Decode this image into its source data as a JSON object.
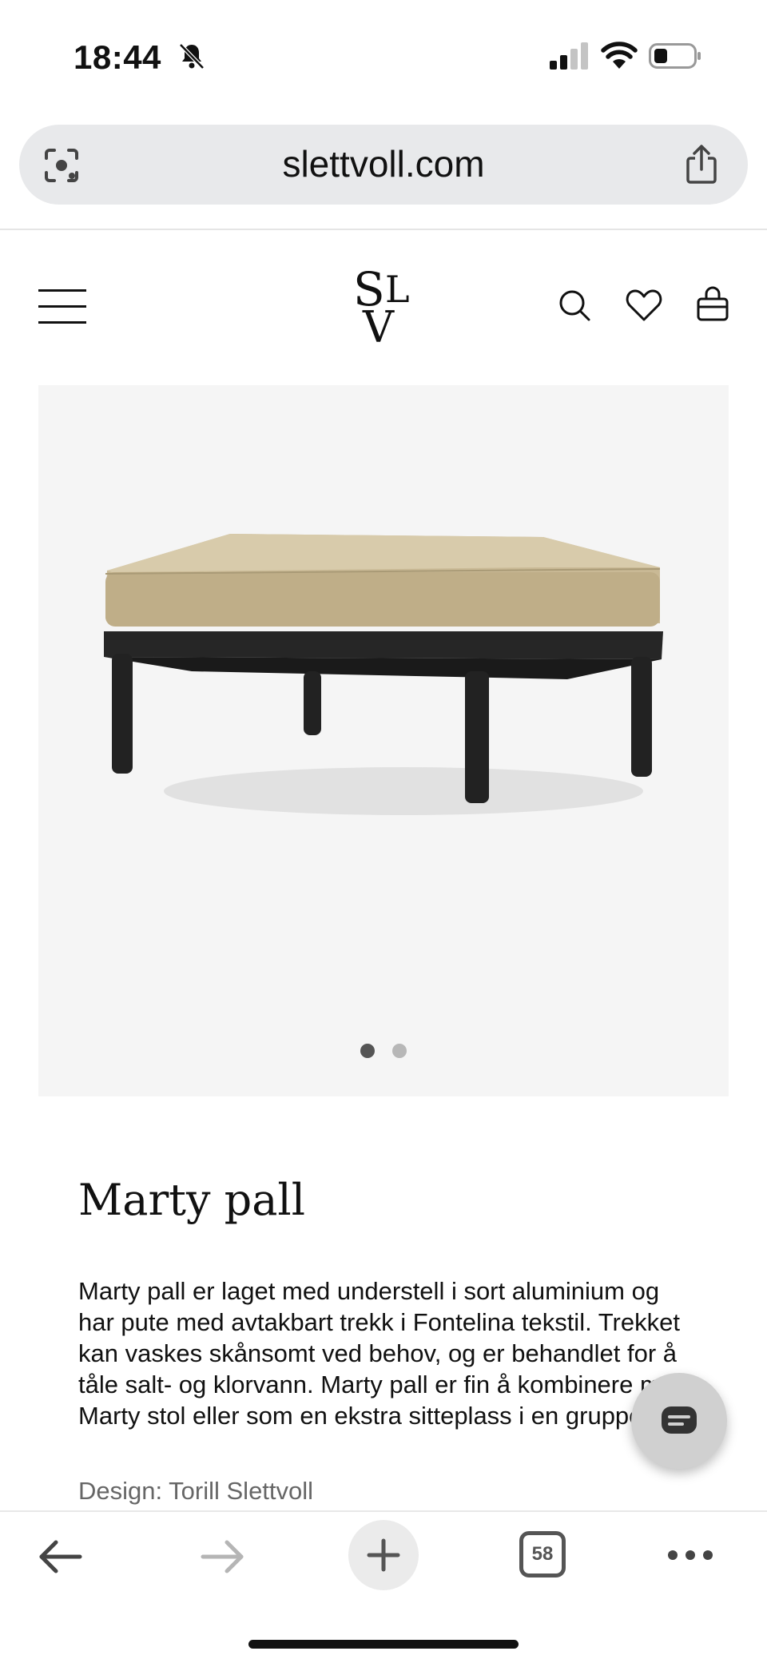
{
  "status_bar": {
    "time": "18:44",
    "icons": [
      "bell-slash-icon",
      "signal-icon",
      "wifi-icon",
      "battery-icon"
    ]
  },
  "browser": {
    "domain": "slettvoll.com",
    "open_tabs": "58",
    "icons": [
      "lens-icon",
      "share-icon",
      "back-arrow-icon",
      "forward-arrow-icon",
      "plus-icon",
      "more-icon"
    ]
  },
  "site_header": {
    "logo_letters": "SLV",
    "icons": [
      "menu-icon",
      "search-icon",
      "heart-icon",
      "bag-icon"
    ]
  },
  "gallery": {
    "image_alt": "Marty pall",
    "slide_count": 2,
    "active_slide": 1,
    "colors": {
      "background": "#f5f5f5",
      "cushion": "#c9b995",
      "frame": "#1f1f1f"
    }
  },
  "product": {
    "name": "Marty pall",
    "description": "Marty pall er laget med understell i sort aluminium og har pute med avtakbart trekk i Fontelina tekstil. Trekket kan vaskes skånsomt ved behov, og er behandlet for å tåle salt- og klorvann. Marty pall er fin å kombinere med Marty stol eller som en ekstra sitteplass i en gruppe.",
    "designer": "Design: Torill Slettvoll"
  },
  "chat": {
    "icon": "chat-icon"
  }
}
